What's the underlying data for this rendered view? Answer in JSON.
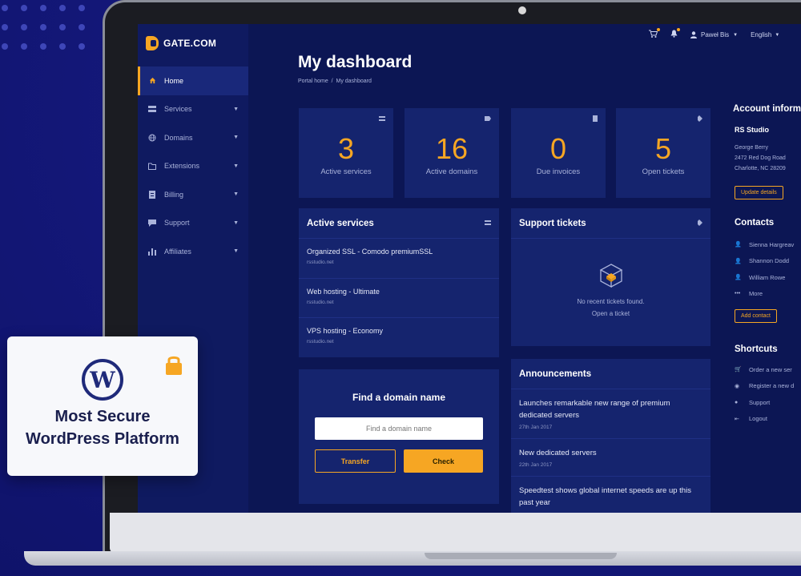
{
  "brand": {
    "name": "GATE.COM",
    "accent": "#f6a623",
    "background": "#14187a"
  },
  "sidebar": {
    "items": [
      {
        "label": "Home",
        "icon": "home-icon",
        "active": true
      },
      {
        "label": "Services",
        "icon": "server-icon"
      },
      {
        "label": "Domains",
        "icon": "globe-icon"
      },
      {
        "label": "Extensions",
        "icon": "folder-icon"
      },
      {
        "label": "Billing",
        "icon": "invoice-icon"
      },
      {
        "label": "Support",
        "icon": "chat-icon"
      },
      {
        "label": "Affiliates",
        "icon": "bar-chart-icon"
      }
    ]
  },
  "topbar": {
    "user": "Paweł Bis",
    "language": "English"
  },
  "page": {
    "title": "My dashboard",
    "breadcrumb_home": "Portal home",
    "breadcrumb_sep": "/",
    "breadcrumb_current": "My dashboard"
  },
  "stats": [
    {
      "value": "3",
      "label": "Active services"
    },
    {
      "value": "16",
      "label": "Active domains"
    },
    {
      "value": "0",
      "label": "Due invoices"
    },
    {
      "value": "5",
      "label": "Open tickets"
    }
  ],
  "active_services": {
    "title": "Active services",
    "items": [
      {
        "name": "Organized SSL - Comodo premiumSSL",
        "domain": "rsstudio.net"
      },
      {
        "name": "Web hosting - Ultimate",
        "domain": "rsstudio.net"
      },
      {
        "name": "VPS hosting - Economy",
        "domain": "rsstudio.net"
      }
    ]
  },
  "support_tickets": {
    "title": "Support tickets",
    "empty_text": "No recent tickets found.",
    "open_link": "Open a ticket"
  },
  "domain_search": {
    "title": "Find a domain name",
    "placeholder": "Find a domain name",
    "transfer_label": "Transfer",
    "check_label": "Check"
  },
  "announcements": {
    "title": "Announcements",
    "items": [
      {
        "title": "Launches remarkable new range of premium dedicated servers",
        "date": "27th Jan 2017"
      },
      {
        "title": "New dedicated servers",
        "date": "22th Jan 2017"
      },
      {
        "title": "Speedtest shows global internet speeds are up this past year",
        "date": ""
      }
    ]
  },
  "account": {
    "title": "Account inform",
    "company": "RS Studio",
    "name": "George Berry",
    "address1": "2472 Red Dog Road",
    "address2": "Charlotte, NC 28209",
    "update_label": "Update details"
  },
  "contacts": {
    "title": "Contacts",
    "items": [
      "Sienna Hargreav",
      "Shannon Dodd",
      "William Rowe",
      "More"
    ],
    "add_label": "Add contact"
  },
  "shortcuts": {
    "title": "Shortcuts",
    "items": [
      "Order a new ser",
      "Register a new d",
      "Support",
      "Logout"
    ]
  },
  "promo": {
    "line1": "Most Secure",
    "line2": "WordPress Platform"
  }
}
